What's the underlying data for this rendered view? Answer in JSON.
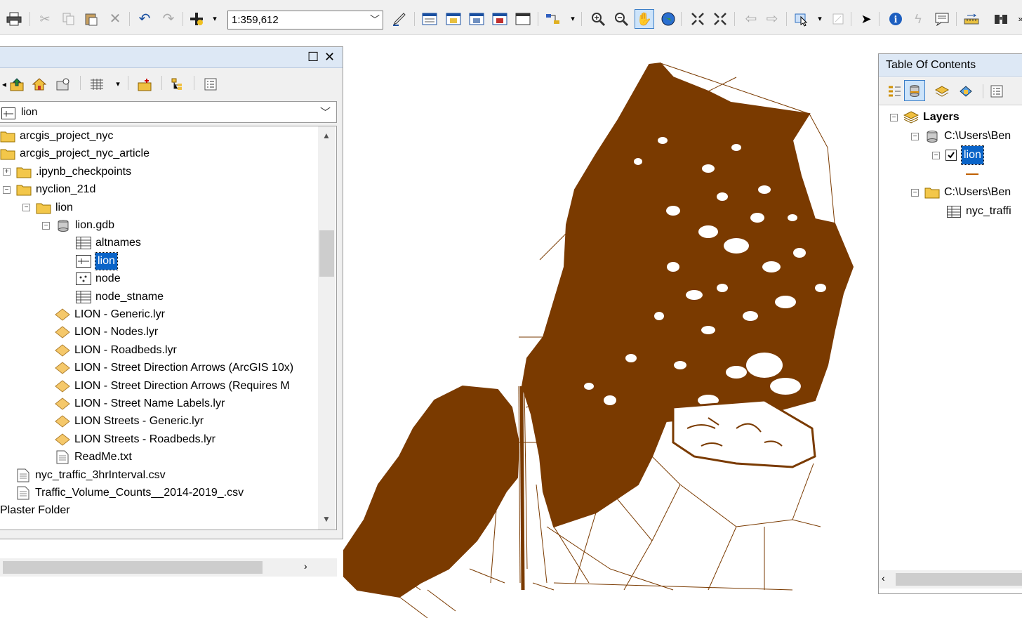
{
  "toolbar": {
    "scale": "1:359,612"
  },
  "catalog": {
    "location_value": "lion",
    "tree": [
      {
        "label": "arcgis_project_nyc",
        "icon": "folder-icon",
        "expander": ""
      },
      {
        "label": "arcgis_project_nyc_article",
        "icon": "folder-icon",
        "expander": ""
      },
      {
        "label": ".ipynb_checkpoints",
        "icon": "folder-icon",
        "expander": "+"
      },
      {
        "label": "nyclion_21d",
        "icon": "folder-icon",
        "expander": "-"
      },
      {
        "label": "lion",
        "icon": "folder-icon",
        "expander": "-"
      },
      {
        "label": "lion.gdb",
        "icon": "geodatabase-icon",
        "expander": "-"
      },
      {
        "label": "altnames",
        "icon": "table-icon",
        "expander": ""
      },
      {
        "label": "lion",
        "icon": "line-feature-class-icon",
        "expander": "",
        "selected": true
      },
      {
        "label": "node",
        "icon": "point-feature-class-icon",
        "expander": ""
      },
      {
        "label": "node_stname",
        "icon": "table-icon",
        "expander": ""
      },
      {
        "label": "LION - Generic.lyr",
        "icon": "layer-file-icon",
        "expander": ""
      },
      {
        "label": "LION - Nodes.lyr",
        "icon": "layer-file-icon",
        "expander": ""
      },
      {
        "label": "LION - Roadbeds.lyr",
        "icon": "layer-file-icon",
        "expander": ""
      },
      {
        "label": "LION - Street Direction Arrows (ArcGIS 10x)",
        "icon": "layer-file-icon",
        "expander": ""
      },
      {
        "label": "LION - Street Direction Arrows (Requires M",
        "icon": "layer-file-icon",
        "expander": ""
      },
      {
        "label": "LION - Street Name Labels.lyr",
        "icon": "layer-file-icon",
        "expander": ""
      },
      {
        "label": "LION Streets - Generic.lyr",
        "icon": "layer-file-icon",
        "expander": ""
      },
      {
        "label": "LION Streets - Roadbeds.lyr",
        "icon": "layer-file-icon",
        "expander": ""
      },
      {
        "label": "ReadMe.txt",
        "icon": "text-file-icon",
        "expander": ""
      },
      {
        "label": "nyc_traffic_3hrInterval.csv",
        "icon": "text-file-icon",
        "expander": ""
      },
      {
        "label": "Traffic_Volume_Counts__2014-2019_.csv",
        "icon": "text-file-icon",
        "expander": ""
      },
      {
        "label": "Plaster Folder",
        "icon": "",
        "expander": ""
      }
    ]
  },
  "toc": {
    "title": "Table Of Contents",
    "layers_label": "Layers",
    "db1": "C:\\Users\\Ben",
    "layer_name": "lion",
    "folder": "C:\\Users\\Ben",
    "table": "nyc_traffi"
  },
  "map": {
    "feature_color": "#7a3a00"
  }
}
